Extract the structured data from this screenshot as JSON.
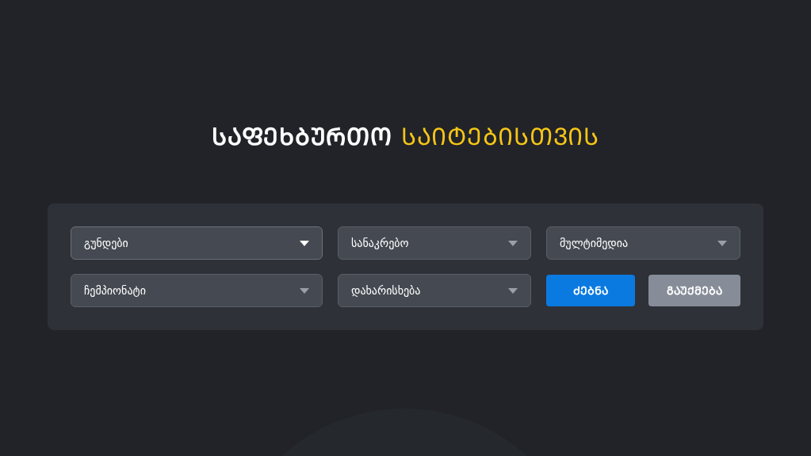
{
  "heading": {
    "bold_part": "ᲡᲐᲤᲔᲮᲑᲣᲠᲗᲝ",
    "accent_part": "ᲡᲐᲘᲢᲔᲑᲘᲡᲗᲕᲘᲡ"
  },
  "filters": [
    {
      "label": "გუნდები",
      "focused": true
    },
    {
      "label": "სანაკრებო",
      "focused": false
    },
    {
      "label": "მულტიმედია",
      "focused": false
    },
    {
      "label": "ჩემპიონატი",
      "focused": false
    },
    {
      "label": "დახარისხება",
      "focused": false
    }
  ],
  "buttons": [
    {
      "label": "ᲫᲔᲑᲜᲐ",
      "kind": "primary"
    },
    {
      "label": "ᲒᲐᲣᲥᲛᲔᲑᲐ",
      "kind": "secondary"
    }
  ]
}
